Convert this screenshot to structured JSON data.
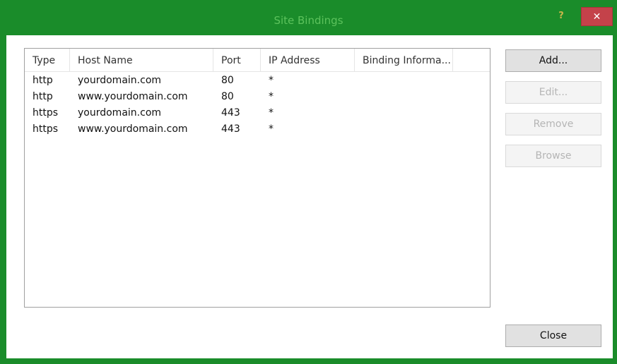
{
  "window": {
    "title": "Site Bindings",
    "help_label": "?",
    "close_label": "✕"
  },
  "colors": {
    "frame": "#1a8c2a",
    "close_button": "#c4424a"
  },
  "bindings_list": {
    "columns": [
      "Type",
      "Host Name",
      "Port",
      "IP Address",
      "Binding Informa..."
    ],
    "rows": [
      [
        "http",
        "yourdomain.com",
        "80",
        "*",
        ""
      ],
      [
        "http",
        "www.yourdomain.com",
        "80",
        "*",
        ""
      ],
      [
        "https",
        "yourdomain.com",
        "443",
        "*",
        ""
      ],
      [
        "https",
        "www.yourdomain.com",
        "443",
        "*",
        ""
      ]
    ]
  },
  "buttons": {
    "add": "Add...",
    "edit": "Edit...",
    "remove": "Remove",
    "browse": "Browse",
    "close": "Close"
  }
}
